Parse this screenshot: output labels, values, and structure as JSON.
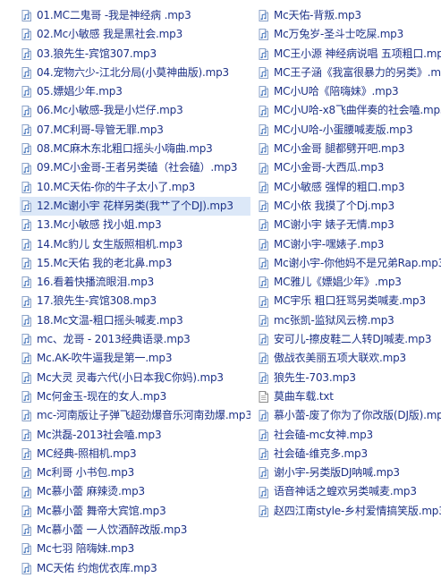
{
  "colors": {
    "text": "#1e3287",
    "selection": "#dce8f8",
    "background": "#ffffff"
  },
  "icons": {
    "audio": "audio-file-icon",
    "text": "text-file-icon"
  },
  "files": {
    "left": [
      {
        "name": "01.MC二鬼哥 -我是神经病 .mp3",
        "icon": "audio"
      },
      {
        "name": "02.Mc小敏感 我是黑社会.mp3",
        "icon": "audio"
      },
      {
        "name": "03.狼先生-宾馆307.mp3",
        "icon": "audio"
      },
      {
        "name": "04.宠物六少-江北分局(小莫神曲版).mp3",
        "icon": "audio"
      },
      {
        "name": "05.嫖娼少年.mp3",
        "icon": "audio"
      },
      {
        "name": "06.Mc小敏感-我是小烂仔.mp3",
        "icon": "audio"
      },
      {
        "name": "07.MC利哥-导管无罪.mp3",
        "icon": "audio"
      },
      {
        "name": "08.MC麻木东北粗口摇头小嗨曲.mp3",
        "icon": "audio"
      },
      {
        "name": "09.MC小金哥-王者另类磕（社会磕）.mp3",
        "icon": "audio"
      },
      {
        "name": "10.MC天佑-你的牛子太小了.mp3",
        "icon": "audio"
      },
      {
        "name": "12.Mc谢小宇 花样另类(我艹了个DJ).mp3",
        "icon": "audio",
        "selected": true
      },
      {
        "name": "13.Mc小敏感 找小姐.mp3",
        "icon": "audio"
      },
      {
        "name": "14.Mc豹儿 女生版照相机.mp3",
        "icon": "audio"
      },
      {
        "name": "15.Mc天佑 我的老北鼻.mp3",
        "icon": "audio"
      },
      {
        "name": "16.看着快播流眼泪.mp3",
        "icon": "audio"
      },
      {
        "name": "17.狼先生-宾馆308.mp3",
        "icon": "audio"
      },
      {
        "name": "18.Mc文温-粗口摇头喊麦.mp3",
        "icon": "audio"
      },
      {
        "name": "mc、龙哥 - 2013经典语录.mp3",
        "icon": "audio"
      },
      {
        "name": "Mc.AK-吹牛逼我是第一.mp3",
        "icon": "audio"
      },
      {
        "name": "Mc大灵 灵毒六代(小日本我C你妈).mp3",
        "icon": "audio"
      },
      {
        "name": "Mc何金玉-现在的女人.mp3",
        "icon": "audio"
      },
      {
        "name": "mc-河南版让子弹飞超劲爆音乐河南劲爆.mp3",
        "icon": "audio"
      },
      {
        "name": "Mc洪磊-2013社会嗑.mp3",
        "icon": "audio"
      },
      {
        "name": "MC经典-照相机.mp3",
        "icon": "audio"
      },
      {
        "name": "Mc利哥 小书包.mp3",
        "icon": "audio"
      },
      {
        "name": "Mc慕小蕾 麻辣烫.mp3",
        "icon": "audio"
      },
      {
        "name": "Mc慕小蕾 舞帝大宾馆.mp3",
        "icon": "audio"
      },
      {
        "name": "Mc慕小蕾 一人饮酒醉改版.mp3",
        "icon": "audio"
      },
      {
        "name": "Mc七羽 陪嗨妹.mp3",
        "icon": "audio"
      },
      {
        "name": "MC天佑 约炮优衣库.mp3",
        "icon": "audio"
      }
    ],
    "right": [
      {
        "name": "Mc天佑-背叛.mp3",
        "icon": "audio"
      },
      {
        "name": "Mc万兔岁-圣斗士吃屎.mp3",
        "icon": "audio"
      },
      {
        "name": "MC王小源 神经病说唱 五项粗口.mp3",
        "icon": "audio"
      },
      {
        "name": "MC王子涵《我富很暴力的另类》.mp3",
        "icon": "audio"
      },
      {
        "name": "MC小U哈《陪嗨妹》.mp3",
        "icon": "audio"
      },
      {
        "name": "MC小U哈-x8飞曲伴奏的社会嗑.mp3",
        "icon": "audio"
      },
      {
        "name": "MC小U哈-小蛋腰喊麦版.mp3",
        "icon": "audio"
      },
      {
        "name": "MC小金哥 腿都劈开吧.mp3",
        "icon": "audio"
      },
      {
        "name": "MC小金哥-大西瓜.mp3",
        "icon": "audio"
      },
      {
        "name": "MC小敏感 强悍的粗口.mp3",
        "icon": "audio"
      },
      {
        "name": "MC小依 我摸了个Dj.mp3",
        "icon": "audio"
      },
      {
        "name": "MC谢小宇 婊子无情.mp3",
        "icon": "audio"
      },
      {
        "name": "MC谢小宇-嘿婊子.mp3",
        "icon": "audio"
      },
      {
        "name": "Mc谢小宇-你他妈不是兄弟Rap.mp3",
        "icon": "audio"
      },
      {
        "name": "MC雅儿《嫖娼少年》.mp3",
        "icon": "audio"
      },
      {
        "name": "MC宇乐 粗口狂骂另类喊麦.mp3",
        "icon": "audio"
      },
      {
        "name": "mc张凯-监狱风云榜.mp3",
        "icon": "audio"
      },
      {
        "name": "安可儿-擦皮鞋二人转DJ喊麦.mp3",
        "icon": "audio"
      },
      {
        "name": "傲战衣美丽五项大联欢.mp3",
        "icon": "audio"
      },
      {
        "name": "狼先生-703.mp3",
        "icon": "audio"
      },
      {
        "name": "莫曲车载.txt",
        "icon": "text"
      },
      {
        "name": "慕小蕾-废了你为了你改版(DJ版).mp3",
        "icon": "audio"
      },
      {
        "name": "社会磕-mc女神.mp3",
        "icon": "audio"
      },
      {
        "name": "社会磕-维克多.mp3",
        "icon": "audio"
      },
      {
        "name": "谢小宇-另类版DJ呐喊.mp3",
        "icon": "audio"
      },
      {
        "name": "语音神话之蝗欢另类喊麦.mp3",
        "icon": "audio"
      },
      {
        "name": "赵四江南style-乡村爱情搞笑版.mp3",
        "icon": "audio"
      }
    ]
  }
}
